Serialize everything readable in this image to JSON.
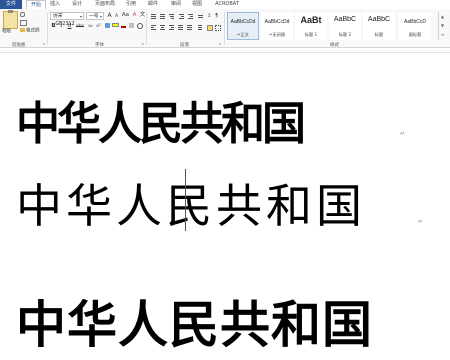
{
  "tabs": [
    {
      "label": "文件",
      "kind": "file"
    },
    {
      "label": "开始",
      "kind": "active"
    },
    {
      "label": "插入"
    },
    {
      "label": "设计"
    },
    {
      "label": "页面布局"
    },
    {
      "label": "引用"
    },
    {
      "label": "邮件"
    },
    {
      "label": "审阅"
    },
    {
      "label": "视图"
    },
    {
      "label": "ACROBAT"
    }
  ],
  "clipboard": {
    "paste_label": "粘贴",
    "format_painter_label": "格式刷",
    "group_label": "剪贴板"
  },
  "font": {
    "font_name": "仿宋_GB2312",
    "font_size": "一号",
    "bold": "B",
    "italic": "I",
    "underline": "U",
    "strike": "abc",
    "subscript": "x₂",
    "superscript": "x²",
    "grow": "A",
    "shrink": "A",
    "case": "Aa",
    "clear": "A",
    "phonetic": "文",
    "group_label": "字体"
  },
  "paragraph": {
    "group_label": "段落"
  },
  "styles": {
    "items": [
      {
        "sample": "AaBbCcDd",
        "name": "↵正文",
        "selected": true,
        "kind": "normal"
      },
      {
        "sample": "AaBbCcDd",
        "name": "↵无间隔",
        "kind": "normal"
      },
      {
        "sample": "AaBt",
        "name": "标题 1",
        "kind": "big"
      },
      {
        "sample": "AaBbC",
        "name": "标题 2",
        "kind": "h2"
      },
      {
        "sample": "AaBbC",
        "name": "标题",
        "kind": "h2"
      },
      {
        "sample": "AaBbCcD",
        "name": "副标题",
        "kind": "normal"
      }
    ],
    "group_label": "样式"
  },
  "document": {
    "line1": "中华人民共和国",
    "line2": "中华人民共和国",
    "line3": "中华人民共和国"
  }
}
